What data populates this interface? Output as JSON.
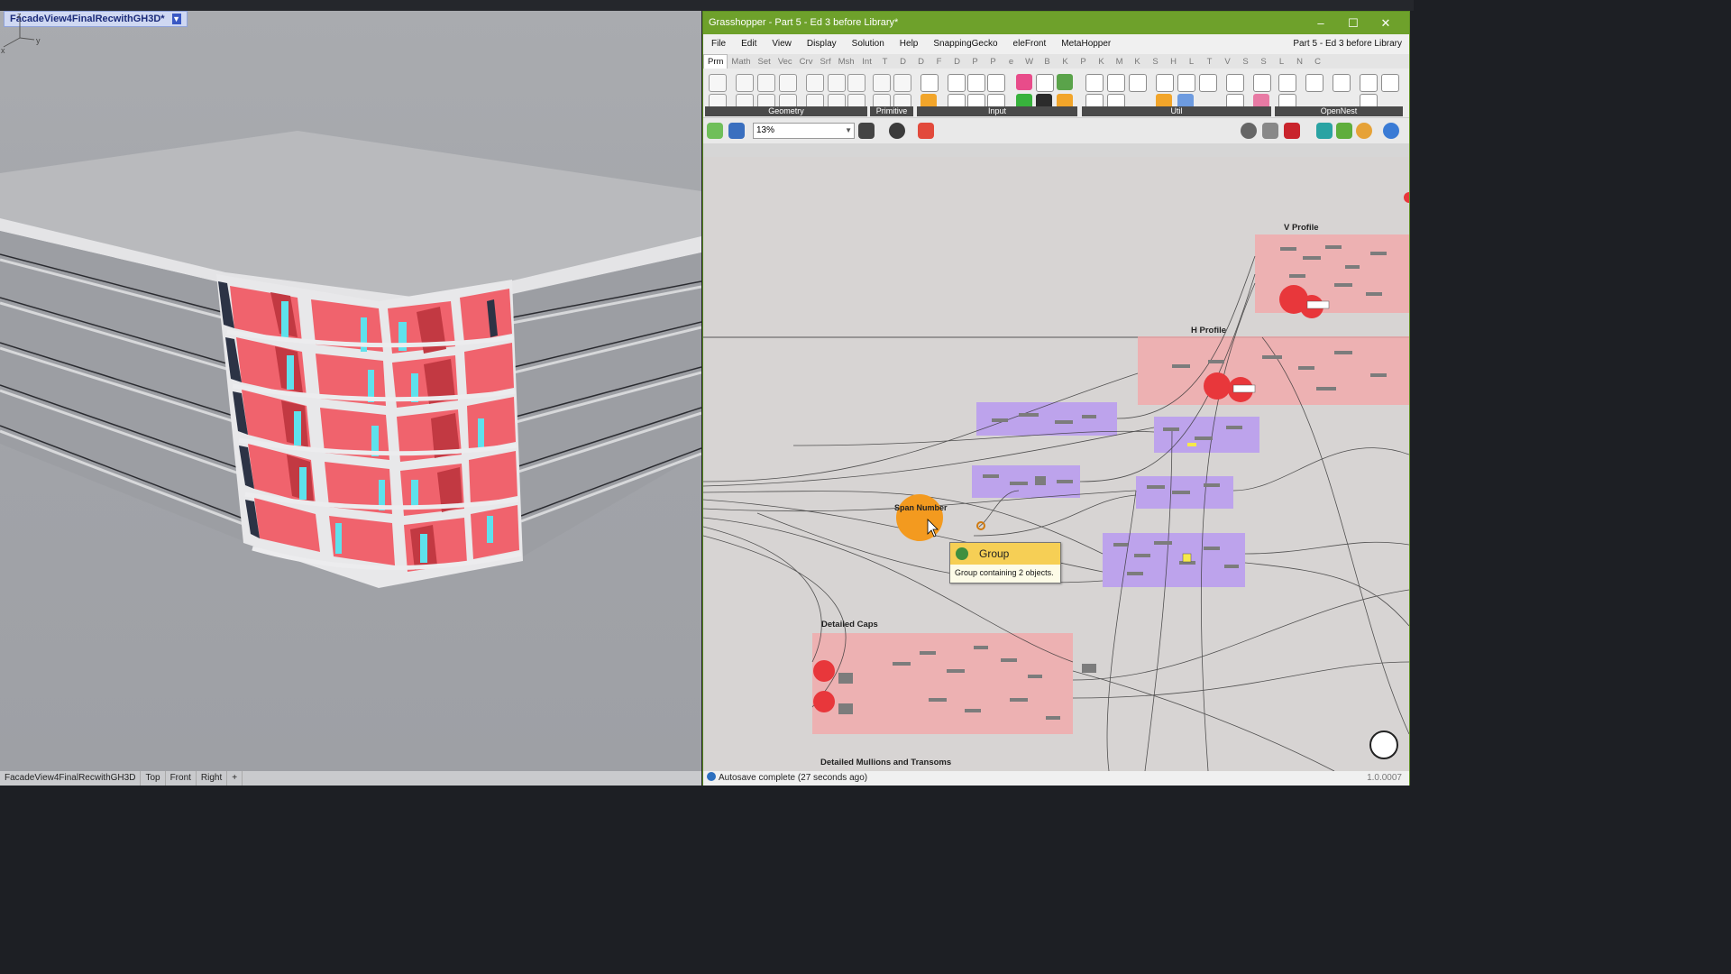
{
  "rhino": {
    "viewport_title": "FacadeView4FinalRecwithGH3D*",
    "axis": {
      "z": "z",
      "x": "x",
      "y": "y"
    },
    "view_tabs": [
      "FacadeView4FinalRecwithGH3D",
      "Top",
      "Front",
      "Right"
    ],
    "add_tab_symbol": "+"
  },
  "grasshopper": {
    "title": "Grasshopper - Part 5 - Ed 3 before Library*",
    "window_buttons": {
      "minimize": "–",
      "maximize": "☐",
      "close": "✕"
    },
    "menu": [
      "File",
      "Edit",
      "View",
      "Display",
      "Solution",
      "Help",
      "SnappingGecko",
      "eleFront",
      "MetaHopper"
    ],
    "document_name": "Part 5 - Ed 3 before Library",
    "tabs": [
      "Prm",
      "Math",
      "Set",
      "Vec",
      "Crv",
      "Srf",
      "Msh",
      "Int",
      "T",
      "D",
      "D",
      "F",
      "D",
      "P",
      "P",
      "e",
      "W",
      "B",
      "K",
      "P",
      "K",
      "M",
      "K",
      "S",
      "H",
      "L",
      "T",
      "V",
      "S",
      "S",
      "L",
      "N",
      "C"
    ],
    "active_tab": "Prm",
    "panels": [
      "Geometry",
      "Primitive",
      "Input",
      "Util",
      "OpenNest"
    ],
    "zoom": "13%",
    "groups": {
      "v_profile": "V Profile",
      "h_profile": "H Profile",
      "span_number": "Span Number",
      "detailed_caps": "Detailed Caps",
      "detailed_mullions": "Detailed Mullions and Transoms"
    },
    "tooltip": {
      "title": "Group",
      "description": "Group containing 2 objects."
    },
    "status": "Autosave complete (27 seconds ago)",
    "version": "1.0.0007",
    "colors": {
      "title_green": "#6ea12b",
      "group_pink": "#f2a7aa",
      "group_purple": "#b99af0",
      "node_red": "#e8373b",
      "span_orange": "#f39a1f"
    }
  }
}
